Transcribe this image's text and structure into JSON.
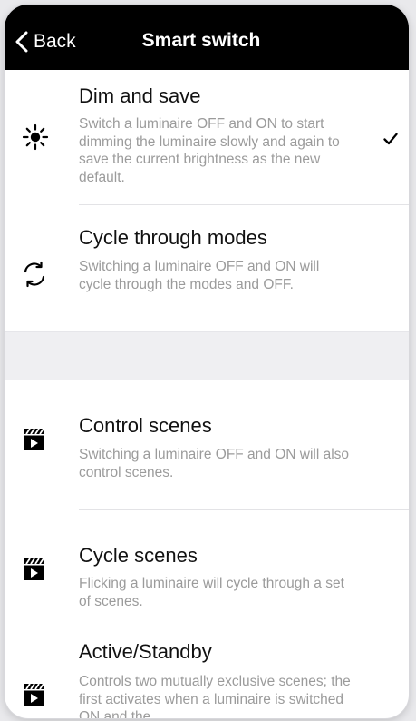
{
  "header": {
    "back_label": "Back",
    "title": "Smart switch"
  },
  "items": [
    {
      "title": "Dim and save",
      "desc": "Switch a luminaire OFF and ON to start dimming the luminaire slowly and again to save the current brightness as the new default.",
      "icon": "sun-icon",
      "selected": true
    },
    {
      "title": "Cycle through modes",
      "desc": "Switching a luminaire OFF and ON will cycle through the modes and OFF.",
      "icon": "cycle-arrows-icon",
      "selected": false
    },
    {
      "title": "Control scenes",
      "desc": "Switching a luminaire OFF and ON will also control scenes.",
      "icon": "clapperboard-icon",
      "selected": false
    },
    {
      "title": "Cycle scenes",
      "desc": "Flicking a luminaire will cycle through a set of scenes.",
      "icon": "clapperboard-icon",
      "selected": false
    },
    {
      "title": "Active/Standby",
      "desc": "Controls two mutually exclusive scenes; the first activates when a luminaire is switched ON and the",
      "icon": "clapperboard-icon",
      "selected": false
    }
  ]
}
